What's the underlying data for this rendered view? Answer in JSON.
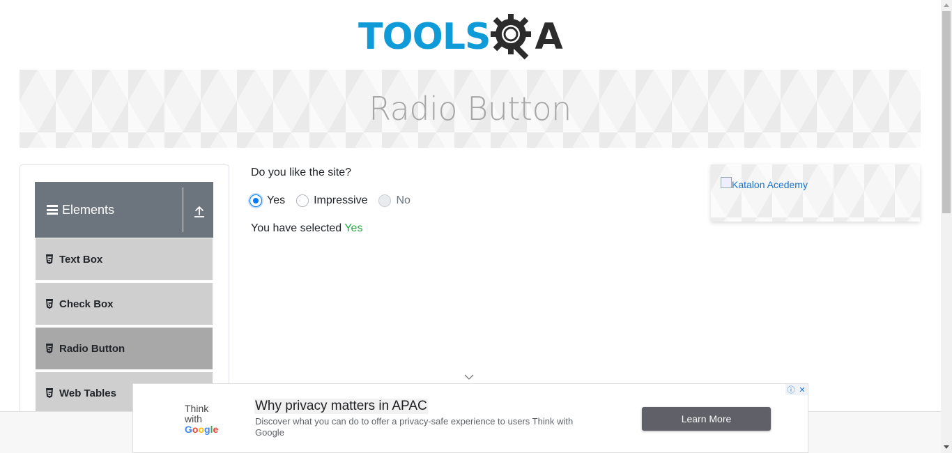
{
  "logo": {
    "part1": "TOOLS",
    "part2": "A",
    "icon": "gear-magnifier-icon"
  },
  "banner": {
    "title": "Radio Button"
  },
  "sidebar": {
    "group": {
      "title": "Elements",
      "icon": "hamburger-icon",
      "toggle_icon": "upload-icon"
    },
    "items": [
      {
        "label": "Text Box",
        "icon": "html5-icon",
        "active": false
      },
      {
        "label": "Check Box",
        "icon": "html5-icon",
        "active": false
      },
      {
        "label": "Radio Button",
        "icon": "html5-icon",
        "active": true
      },
      {
        "label": "Web Tables",
        "icon": "html5-icon",
        "active": false
      }
    ]
  },
  "main": {
    "question": "Do you like the site?",
    "options": [
      {
        "label": "Yes",
        "checked": true,
        "disabled": false
      },
      {
        "label": "Impressive",
        "checked": false,
        "disabled": false
      },
      {
        "label": "No",
        "checked": false,
        "disabled": true
      }
    ],
    "result_prefix": "You have selected",
    "result_value": "Yes"
  },
  "side_ad": {
    "alt_text": "Katalon Acedemy"
  },
  "bottom_ad": {
    "logo_think": "Think",
    "logo_with": "with",
    "logo_google": [
      "G",
      "o",
      "o",
      "g",
      "l",
      "e"
    ],
    "headline": "Why privacy matters in APAC",
    "description": "Discover what you can do to offer a privacy-safe experience to users Think with Google",
    "button_label": "Learn More",
    "info_icon": "ⓘ",
    "close_icon": "✕"
  },
  "colors": {
    "brand_blue": "#0f9bd7",
    "accent": "#007bff",
    "success": "#28a745",
    "group_header": "#6c757d"
  }
}
